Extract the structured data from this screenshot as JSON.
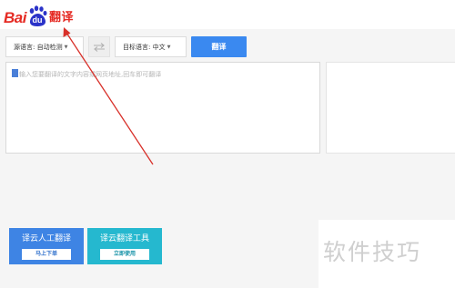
{
  "header": {
    "logo": {
      "text_left": "Bai",
      "text_paw": "du",
      "text_cn": "翻译"
    }
  },
  "toolbar": {
    "source_language": "源语言: 自动检测",
    "target_language": "目标语言: 中文",
    "swap_icon": "swap-arrows-icon",
    "translate_label": "翻译"
  },
  "input": {
    "placeholder": "输入您要翻译的文字内容或网页地址,回车即可翻译"
  },
  "promos": [
    {
      "title": "译云人工翻译",
      "button": "马上下单"
    },
    {
      "title": "译云翻译工具",
      "button": "立即使用"
    }
  ],
  "watermark": "软件技巧",
  "colors": {
    "brand_red": "#e52a23",
    "paw_blue": "#2b33c9",
    "translate_blue": "#3a89f0",
    "annotation_red": "#d8312a",
    "promo_blue": "#3e84e4",
    "promo_cyan": "#25b8cf"
  }
}
